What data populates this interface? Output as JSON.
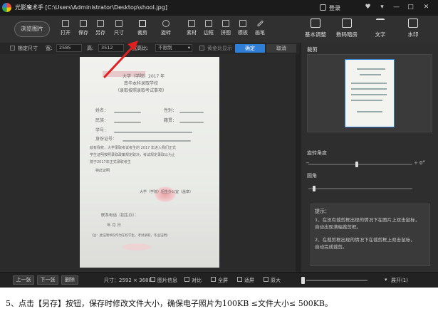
{
  "app": {
    "title": "光影魔术手 [C:\\Users\\Administrator\\Desktop\\shool.jpg]",
    "login_label": "登录",
    "window_controls": [
      "♥",
      "▾",
      "—",
      "□",
      "✕"
    ]
  },
  "toolbar": {
    "browse_label": "浏览图片",
    "tools": [
      {
        "label": "打开",
        "icon": "open-icon"
      },
      {
        "label": "保存",
        "icon": "save-icon"
      },
      {
        "label": "另存",
        "icon": "save-as-icon"
      },
      {
        "label": "尺寸",
        "icon": "resize-icon"
      },
      {
        "label": "裁剪",
        "icon": "crop-icon"
      },
      {
        "label": "旋转",
        "icon": "rotate-icon"
      },
      {
        "label": "素材",
        "icon": "material-icon"
      },
      {
        "label": "边框",
        "icon": "border-icon"
      },
      {
        "label": "拼图",
        "icon": "collage-icon"
      },
      {
        "label": "模板",
        "icon": "template-icon"
      },
      {
        "label": "画笔",
        "icon": "brush-icon"
      }
    ],
    "panel_tabs": [
      {
        "label": "基本调整",
        "icon": "adjust-icon"
      },
      {
        "label": "数码暗房",
        "icon": "darkroom-icon"
      },
      {
        "label": "文字",
        "icon": "text-icon"
      },
      {
        "label": "水印",
        "icon": "watermark-icon"
      }
    ]
  },
  "options": {
    "lock_size_label": "锁定尺寸",
    "width_label": "宽:",
    "width_value": "2585",
    "height_label": "高:",
    "height_value": "3512",
    "ratio_label": "宽高比:",
    "ratio_value": "不限制",
    "ratio_chevron": "▾",
    "show_grid_label": "黄金比显示",
    "confirm_label": "确定",
    "cancel_label": "取消"
  },
  "document": {
    "line1": "大学（学院）2017 年",
    "line2": "南华本科录取学校",
    "line3": "（录取按照录取考试事项）",
    "field1": "姓名：",
    "field1b": "性别：",
    "field2": "民族：",
    "field2b": "籍贯：",
    "field3": "学号：",
    "field4": "身份证号：",
    "body1": "兹有我校，大学录取考试考生的 2017 年进入我们正式",
    "body2": "学生证明按照录取政策规定取决，考试规定录取以为止",
    "body3": "院于2017年正式录取考生",
    "body4": "特此证明",
    "sign": "大学（学院）招生办公室（盖章）",
    "contact": "联系电话（招生办）：",
    "date": "年    月    日",
    "note": "（注：此证明书仅作为在校学生，考试录取，毕业证明）"
  },
  "bottom": {
    "prev_label": "上一张",
    "next_label": "下一张",
    "delete_label": "删除",
    "size_label": "尺寸：2592 × 3688",
    "info_label": "图片信息",
    "compare_label": "对比",
    "fullscreen_label": "全屏",
    "fit_label": "适屏",
    "original_label": "原大",
    "expand_label": "展开",
    "expand_value": "(1)"
  },
  "panel": {
    "crop_title": "裁剪",
    "rotate_label": "旋转角度",
    "rotate_value": "0°",
    "corner_label": "圆角",
    "slider_minus": "−",
    "slider_plus": "+",
    "tips_title": "提示：",
    "tips1a": "1、在没有裁剪框出现的情况下在图片上双击鼠标，",
    "tips1b": "自动出现满幅裁剪框。",
    "tips2a": "2、在裁剪框出现的情况下在裁剪框上双击鼠标，",
    "tips2b": "自动完成裁剪。"
  },
  "caption": "5、点击【另存】按钮，保存时修改文件大小，确保电子照片为100KB ≤文件大小≤ 500KB。",
  "colors": {
    "accent": "#2f7fd6",
    "arrow": "#e02020",
    "background": "#2b2b2b"
  }
}
